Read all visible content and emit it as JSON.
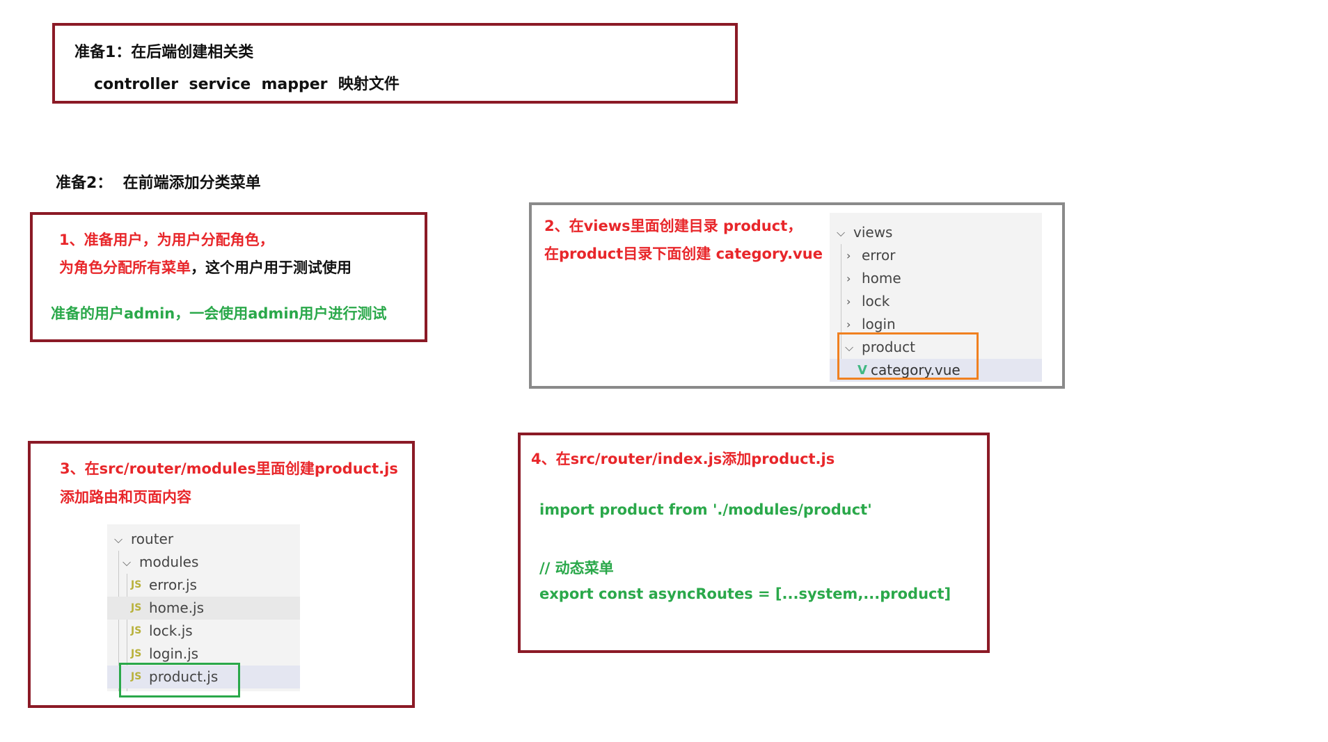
{
  "prep1": {
    "title": "准备1：在后端创建相关类",
    "items": "controller  service  mapper  映射文件"
  },
  "prep2": {
    "title": "准备2：  在前端添加分类菜单"
  },
  "step1": {
    "line1": "1、准备用户，为用户分配角色，",
    "line2_red": "为角色分配所有菜单",
    "line2_black": "，这个用户用于测试使用",
    "note": "准备的用户admin，一会使用admin用户进行测试"
  },
  "step2": {
    "line1": "2、在views里面创建目录 product，",
    "line2": "在product目录下面创建 category.vue",
    "tree": {
      "root": "views",
      "items": [
        "error",
        "home",
        "lock",
        "login"
      ],
      "folder": "product",
      "file": "category.vue",
      "file_icon": "vue-icon"
    }
  },
  "step3": {
    "line1": "3、在src/router/modules里面创建product.js",
    "line2": "添加路由和页面内容",
    "tree": {
      "root": "router",
      "folder": "modules",
      "files": [
        "error.js",
        "home.js",
        "lock.js",
        "login.js",
        "product.js"
      ],
      "file_icon": "js-icon",
      "file_icon_text": "JS"
    }
  },
  "step4": {
    "title": "4、在src/router/index.js添加product.js",
    "code1": "import product from './modules/product'",
    "comment": "// 动态菜单",
    "code2": "export const asyncRoutes = [...system,...product]"
  },
  "colors": {
    "maroon_border": "#8b1a26",
    "grey_border": "#8a8a8a",
    "red_text": "#e8262a",
    "green_text": "#2aa84a",
    "orange_frame": "#f08020",
    "green_frame": "#2aa84a"
  }
}
